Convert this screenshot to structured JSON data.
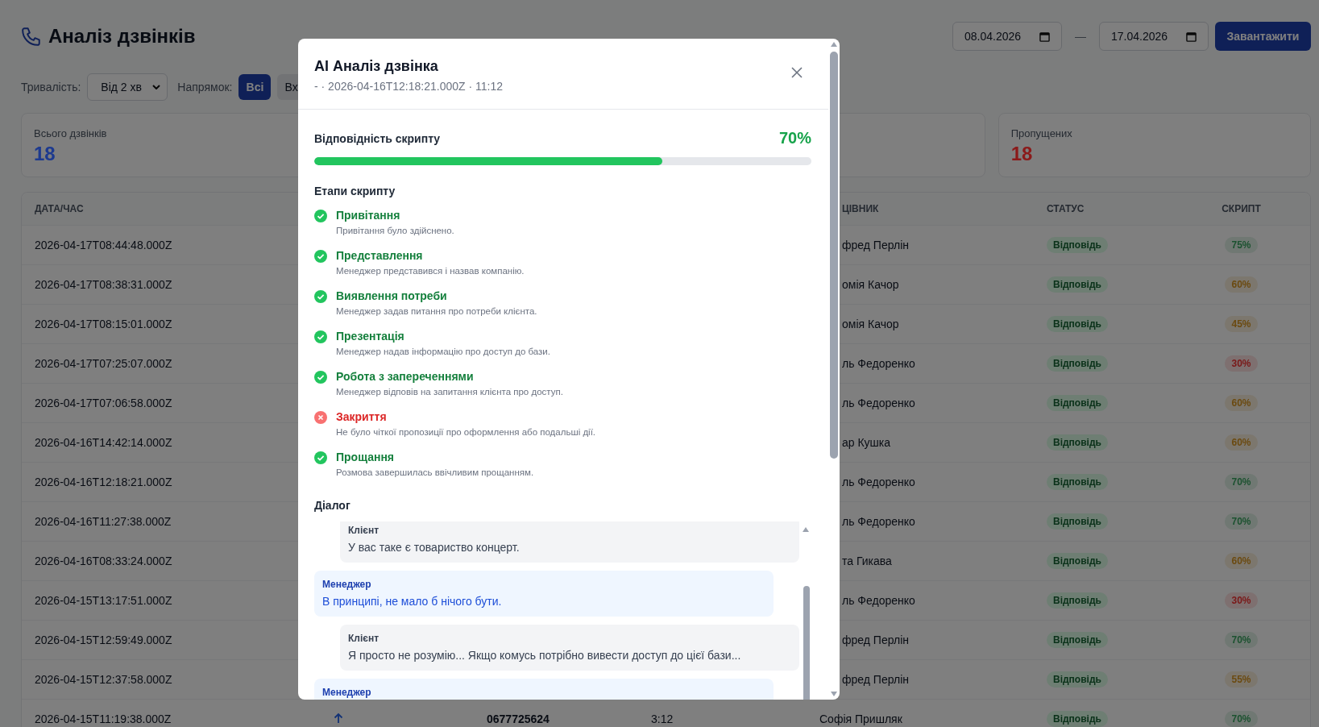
{
  "header": {
    "title": "Аналіз дзвінків",
    "date_from": "08.04.2026",
    "date_separator": "—",
    "date_to": "17.04.2026",
    "load_button": "Завантажити"
  },
  "filters": {
    "duration_label": "Тривалість:",
    "duration_value": "Від 2 хв",
    "direction_label": "Напрямок:",
    "direction_options": [
      {
        "label": "Всі",
        "selected": true
      },
      {
        "label": "Вх",
        "selected": false
      }
    ]
  },
  "stats": [
    {
      "kind": "stat",
      "label": "Всього дзвінків",
      "value": "18",
      "color": "#1d3a8f"
    },
    {
      "kind": "blank"
    },
    {
      "kind": "blank"
    },
    {
      "kind": "stat",
      "label": "Пропущених",
      "value": "18",
      "color": "#8b1a1a"
    }
  ],
  "table": {
    "columns": [
      {
        "kind": "date",
        "label": "ДАТА/ЧАС"
      },
      {
        "kind": "employee",
        "label": "ЦІВНИК"
      },
      {
        "kind": "status",
        "label": "СТАТУС"
      },
      {
        "kind": "script",
        "label": "СКРИПТ"
      }
    ],
    "rows": [
      {
        "date": "2026-04-17T08:44:48.000Z",
        "employee": "фред Перлін",
        "status": "Відповідь",
        "script": "75%",
        "color": "#1c5230"
      },
      {
        "date": "2026-04-17T08:38:31.000Z",
        "employee": "омія Качор",
        "status": "Відповідь",
        "script": "60%",
        "color": "#6b4a10"
      },
      {
        "date": "2026-04-17T08:15:01.000Z",
        "employee": "омія Качор",
        "status": "Відповідь",
        "script": "45%",
        "color": "#6b4a10"
      },
      {
        "date": "2026-04-17T07:25:07.000Z",
        "employee": "ль Федоренко",
        "status": "Відповідь",
        "script": "30%",
        "color": "#7a1818"
      },
      {
        "date": "2026-04-17T07:06:58.000Z",
        "employee": "ль Федоренко",
        "status": "Відповідь",
        "script": "60%",
        "color": "#6b4a10"
      },
      {
        "date": "2026-04-16T14:42:14.000Z",
        "employee": "ар Кушка",
        "status": "Відповідь",
        "script": "60%",
        "color": "#6b4a10"
      },
      {
        "date": "2026-04-16T12:18:21.000Z",
        "employee": "ль Федоренко",
        "status": "Відповідь",
        "script": "70%",
        "color": "#1c5230"
      },
      {
        "date": "2026-04-16T11:27:38.000Z",
        "employee": "ль Федоренко",
        "status": "Відповідь",
        "script": "70%",
        "color": "#1c5230"
      },
      {
        "date": "2026-04-16T08:33:24.000Z",
        "employee": "та Гикава",
        "status": "Відповідь",
        "script": "60%",
        "color": "#6b4a10"
      },
      {
        "date": "2026-04-15T13:17:51.000Z",
        "employee": "ль Федоренко",
        "status": "Відповідь",
        "script": "30%",
        "color": "#7a1818"
      },
      {
        "date": "2026-04-15T12:59:49.000Z",
        "employee": "фред Перлін",
        "status": "Відповідь",
        "script": "70%",
        "color": "#1c5230"
      },
      {
        "date": "2026-04-15T12:37:58.000Z",
        "employee": "фред Перлін",
        "status": "Відповідь",
        "script": "55%",
        "color": "#6b4a10"
      },
      {
        "date": "2026-04-15T11:19:38.000Z",
        "outgoing": true,
        "phone": "0677725624",
        "duration": "3:12",
        "employee": "Софія Пришляк",
        "status": "Відповідь",
        "script": "70%",
        "color": "#1c5230"
      }
    ]
  },
  "modal": {
    "title": "AI Аналіз дзвінка",
    "subtitle": "- · 2026-04-16T12:18:21.000Z · 11:12",
    "score_label": "Відповідність скрипту",
    "score_value": "70%",
    "level": 0.7,
    "stages_title": "Етапи скрипту",
    "stages": [
      {
        "title": "Привітання",
        "note": "Привітання було здійснено.",
        "passed": true
      },
      {
        "title": "Представлення",
        "note": "Менеджер представився і назвав компанію.",
        "passed": true
      },
      {
        "title": "Виявлення потреби",
        "note": "Менеджер задав питання про потреби клієнта.",
        "passed": true
      },
      {
        "title": "Презентація",
        "note": "Менеджер надав інформацію про доступ до бази.",
        "passed": true
      },
      {
        "title": "Робота з запереченнями",
        "note": "Менеджер відповів на запитання клієнта про доступ.",
        "passed": true
      },
      {
        "title": "Закриття",
        "note": "Не було чіткої пропозиції про оформлення або подальші дії.",
        "passed": false
      },
      {
        "title": "Прощання",
        "note": "Розмова завершилась ввічливим прощанням.",
        "passed": true
      }
    ],
    "dialog_title": "Діалог",
    "messages": [
      {
        "kind": "client",
        "speaker": "Клієнт",
        "text": "У вас таке є товариство концерт."
      },
      {
        "kind": "manager",
        "speaker": "Менеджер",
        "text": "В принципі, не мало б нічого бути."
      },
      {
        "kind": "client",
        "speaker": "Клієнт",
        "text": "Я просто не розумію... Якщо комусь потрібно вивести доступ до цієї бази..."
      },
      {
        "kind": "manager",
        "speaker": "Менеджер"
      }
    ]
  }
}
